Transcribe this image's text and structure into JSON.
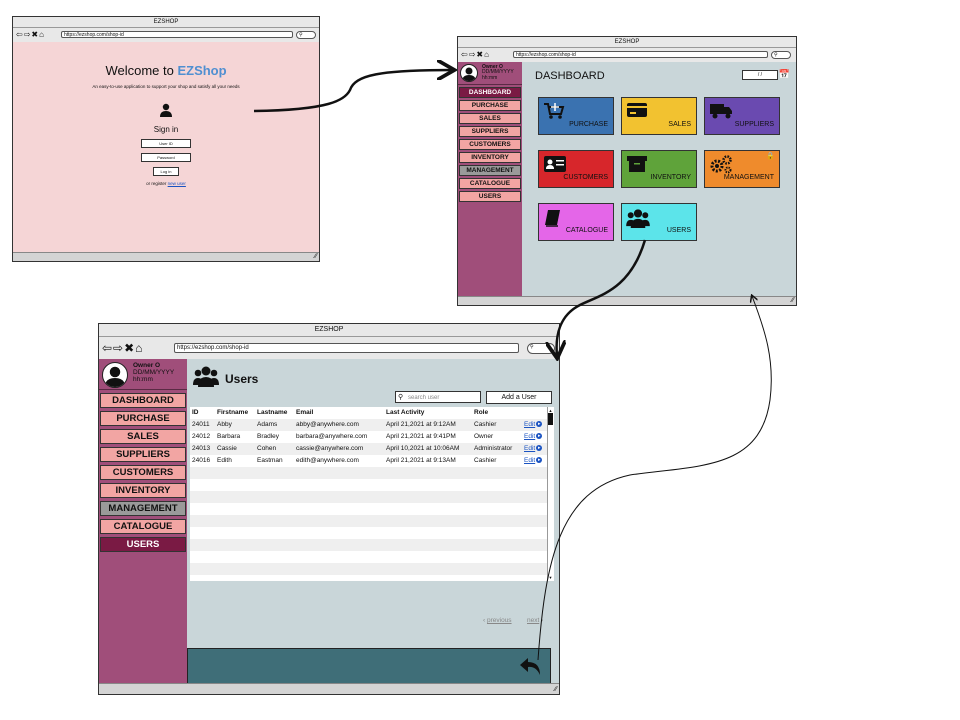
{
  "login_window": {
    "window_title": "EZSHOP",
    "url": "https://ezshop.com/shop-id",
    "welcome_prefix": "Welcome to ",
    "welcome_brand": "EZShop",
    "tagline": "An easy-to-use application to support your shop and satisfy all your needs",
    "sign_in": "Sign in",
    "user_id_placeholder": "User ID",
    "password_placeholder": "Password",
    "login_button": "Log in",
    "register_text": "or register ",
    "register_link": "new user"
  },
  "dashboard_window": {
    "window_title": "EZSHOP",
    "url": "https://ezshop.com/shop-id",
    "owner": "Owner O",
    "date": "DD/MM/YYYY",
    "time": "hh:mm",
    "page_title": "DASHBOARD",
    "date_field": "/ /",
    "sidebar": [
      "DASHBOARD",
      "PURCHASE",
      "SALES",
      "SUPPLIERS",
      "CUSTOMERS",
      "INVENTORY",
      "MANAGEMENT",
      "CATALOGUE",
      "USERS"
    ],
    "tiles": [
      {
        "label": "PURCHASE",
        "color": "#3a72b0",
        "icon": "cart-icon"
      },
      {
        "label": "SALES",
        "color": "#f2c230",
        "icon": "credit-card-icon"
      },
      {
        "label": "SUPPLIERS",
        "color": "#6a4ab0",
        "icon": "truck-icon"
      },
      {
        "label": "CUSTOMERS",
        "color": "#d7262b",
        "icon": "id-card-icon"
      },
      {
        "label": "INVENTORY",
        "color": "#5fa33a",
        "icon": "box-icon"
      },
      {
        "label": "MANAGEMENT",
        "color": "#ef8b2c",
        "icon": "gears-icon"
      },
      {
        "label": "CATALOGUE",
        "color": "#e466e8",
        "icon": "book-icon"
      },
      {
        "label": "USERS",
        "color": "#5ce4ea",
        "icon": "users-icon"
      }
    ]
  },
  "users_window": {
    "window_title": "EZSHOP",
    "url": "https://ezshop.com/shop-id",
    "owner": "Owner O",
    "date": "DD/MM/YYYY",
    "time": "hh:mm",
    "sidebar": [
      "DASHBOARD",
      "PURCHASE",
      "SALES",
      "SUPPLIERS",
      "CUSTOMERS",
      "INVENTORY",
      "MANAGEMENT",
      "CATALOGUE",
      "USERS"
    ],
    "page_title": "Users",
    "search_placeholder": "search user",
    "add_button": "Add a User",
    "columns": [
      "ID",
      "Firstname",
      "Lastname",
      "Email",
      "Last Activity",
      "Role"
    ],
    "rows": [
      {
        "id": "24011",
        "first": "Abby",
        "last": "Adams",
        "email": "abby@anywhere.com",
        "activity": "April 21,2021 at 9:12AM",
        "role": "Cashier",
        "edit": "Edit"
      },
      {
        "id": "24012",
        "first": "Barbara",
        "last": "Bradley",
        "email": "barbara@anywhere.com",
        "activity": "April 21,2021 at 9:41PM",
        "role": "Owner",
        "edit": "Edit"
      },
      {
        "id": "24013",
        "first": "Cassie",
        "last": "Cohen",
        "email": "cassie@anywhere.com",
        "activity": "April 10,2021 at 10:06AM",
        "role": "Administrator",
        "edit": "Edit"
      },
      {
        "id": "24016",
        "first": "Edith",
        "last": "Eastman",
        "email": "edith@anywhere.com",
        "activity": "April 21,2021 at 9:13AM",
        "role": "Cashier",
        "edit": "Edit"
      }
    ],
    "previous": "previous",
    "next": "next"
  }
}
